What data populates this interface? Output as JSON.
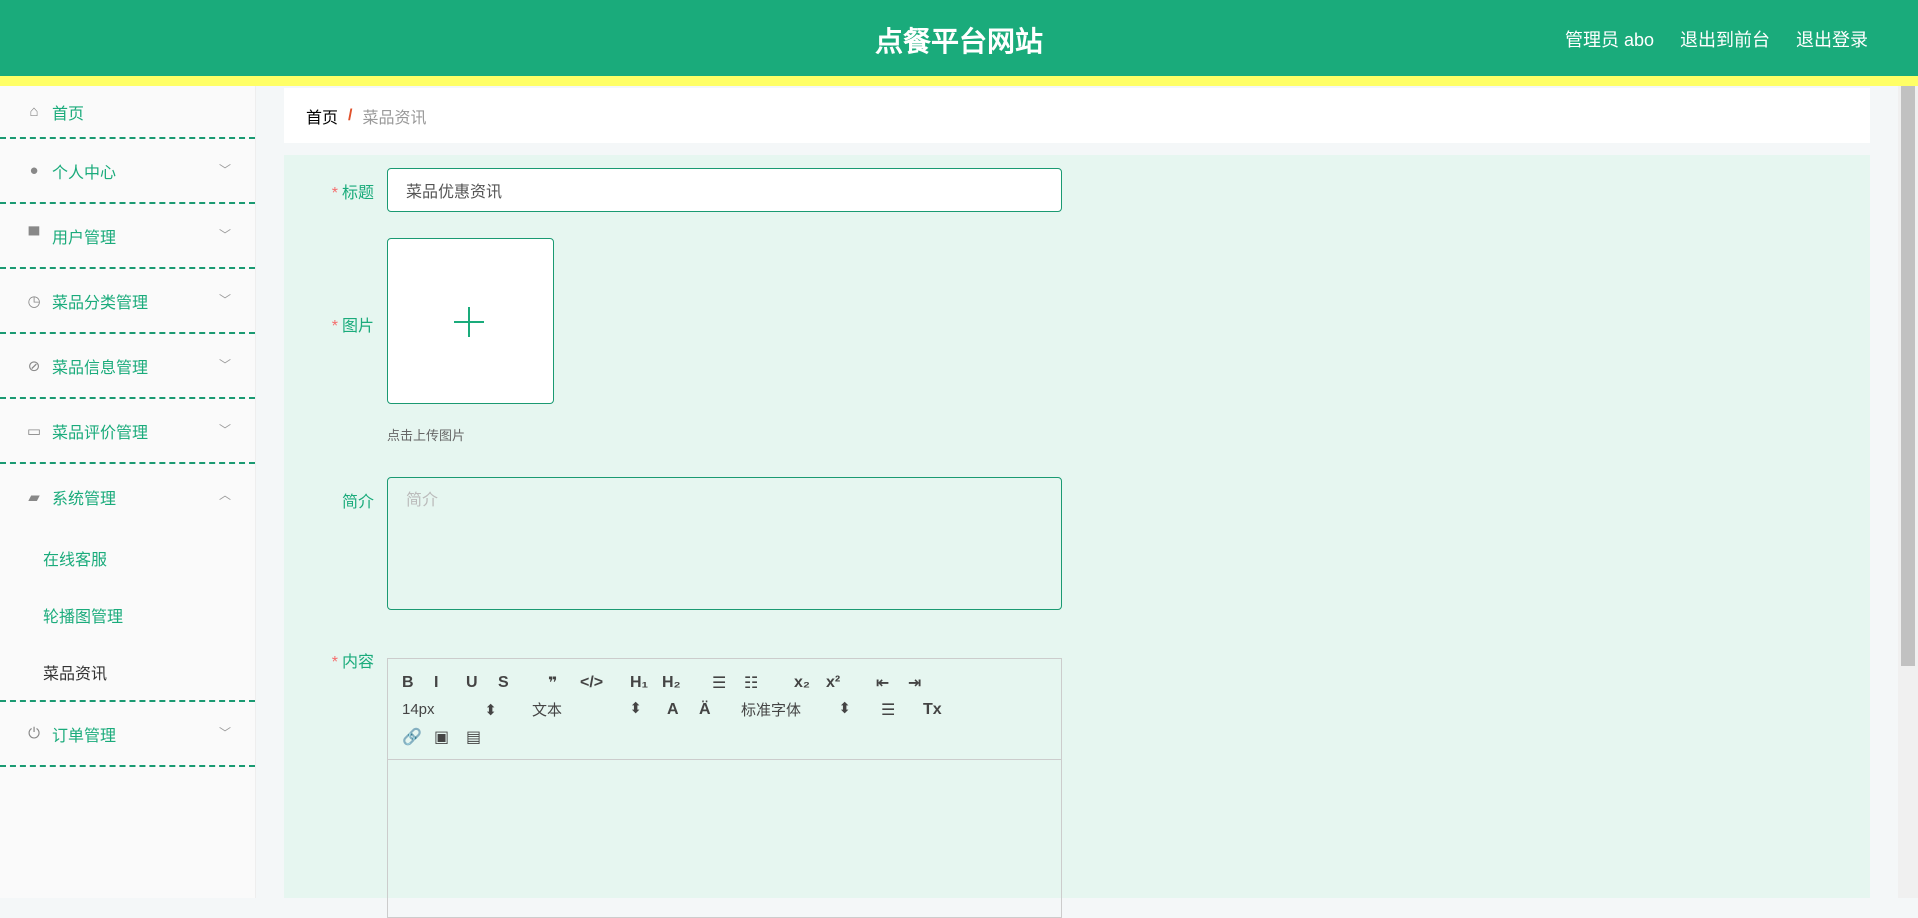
{
  "header": {
    "title": "点餐平台网站",
    "user": "管理员 abo",
    "to_front": "退出到前台",
    "logout": "退出登录"
  },
  "sidebar": {
    "items": [
      {
        "label": "首页",
        "icon": "home-icon"
      },
      {
        "label": "个人中心",
        "icon": "user-icon"
      },
      {
        "label": "用户管理",
        "icon": "monitor-icon"
      },
      {
        "label": "菜品分类管理",
        "icon": "clock-icon"
      },
      {
        "label": "菜品信息管理",
        "icon": "compass-icon"
      },
      {
        "label": "菜品评价管理",
        "icon": "card-icon"
      },
      {
        "label": "系统管理",
        "icon": "wallet-icon"
      },
      {
        "label": "订单管理",
        "icon": "power-icon"
      }
    ],
    "sub": [
      "在线客服",
      "轮播图管理",
      "菜品资讯"
    ]
  },
  "breadcrumb": {
    "home": "首页",
    "sep": "/",
    "current": "菜品资讯"
  },
  "form": {
    "title_label": "标题",
    "title_value": "菜品优惠资讯",
    "image_label": "图片",
    "upload_hint": "点击上传图片",
    "intro_label": "简介",
    "intro_placeholder": "简介",
    "content_label": "内容",
    "star": "*"
  },
  "editor": {
    "row1": [
      "B",
      "I",
      "U",
      "S",
      "❞",
      "</>",
      "H₁",
      "H₂",
      "☰",
      "☷",
      "x₂",
      "x²",
      "⇤",
      "⇥"
    ],
    "font_size": "14px",
    "heading": "文本",
    "font_family": "标准字体",
    "row2": [
      "A",
      "Ä",
      "☰",
      "Tx"
    ],
    "row3": [
      "🔗",
      "▣",
      "▤"
    ]
  }
}
